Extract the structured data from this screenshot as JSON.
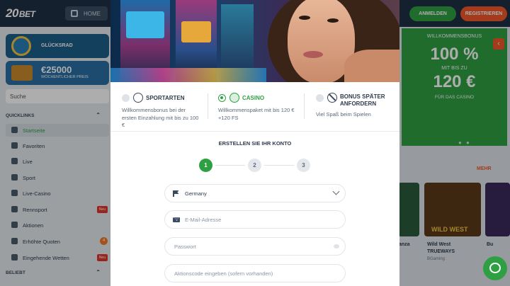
{
  "header": {
    "logo_number": "20",
    "logo_text": "BET",
    "home_label": "HOME",
    "login_label": "ANMELDEN",
    "register_label": "REGISTRIEREN"
  },
  "sidebar": {
    "promo1": "GLÜCKSRAD",
    "promo2_amount": "€25000",
    "promo2_sub": "WÖCHENTLICHER PREIS",
    "search_placeholder": "Suche",
    "section_quicklinks": "QUICKLINKS",
    "section_beliebt": "BELIEBT",
    "items": [
      {
        "label": "Startseite"
      },
      {
        "label": "Favoriten"
      },
      {
        "label": "Live"
      },
      {
        "label": "Sport"
      },
      {
        "label": "Live-Casino"
      },
      {
        "label": "Rennsport",
        "badge": "Neu"
      },
      {
        "label": "Aktionen"
      },
      {
        "label": "Erhöhte Quoten",
        "count": "4"
      },
      {
        "label": "Eingehende Wetten",
        "badge": "Neu"
      }
    ]
  },
  "right_panel": {
    "title": "WILLKOMMENSBONUS",
    "line1": "100 %",
    "line2": "MIT BIS ZU",
    "line3": "120 €",
    "line4": "FÜR DAS CASINO",
    "more_label": "MEHR",
    "game1_name": "Wild West",
    "game1_sub": "TRUEWAYS",
    "game1_provider": "BGaming",
    "game0_name": "anza",
    "game2_name": "Bu",
    "tile_text": "WILD WEST"
  },
  "modal": {
    "options": [
      {
        "title": "SPORTARTEN",
        "desc": "Willkommensbonus bei der ersten Einzahlung mit bis zu 100 €"
      },
      {
        "title": "CASINO",
        "desc": "Willkommenspaket mit bis 120 € +120 FS"
      },
      {
        "title": "BONUS SPÄTER ANFORDERN",
        "desc": "Viel Spaß beim Spielen"
      }
    ],
    "form_title": "ERSTELLEN SIE IHR KONTO",
    "steps": [
      "1",
      "2",
      "3"
    ],
    "country_value": "Germany",
    "email_placeholder": "E-Mail-Adresse",
    "password_placeholder": "Passwort",
    "promo_placeholder": "Aktionscode eingeben (sofern vorhanden)"
  },
  "colors": {
    "accent_green": "#2f9f43",
    "accent_orange": "#f0582a",
    "header_bg": "#1f3044"
  }
}
